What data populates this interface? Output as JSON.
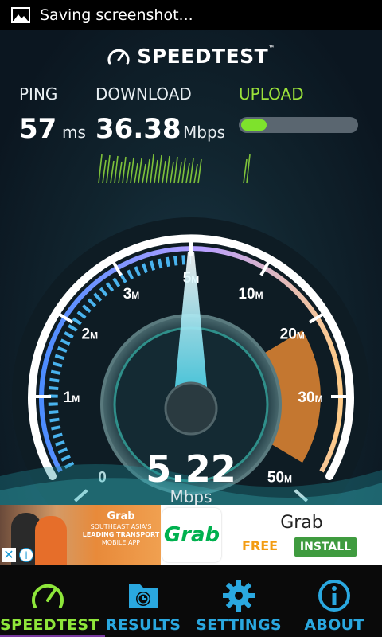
{
  "status_bar": {
    "text": "Saving screenshot..."
  },
  "app": {
    "brand": "SPEEDTEST",
    "trademark": "™"
  },
  "metrics": {
    "ping": {
      "label": "PING",
      "value": "57",
      "unit": "ms"
    },
    "download": {
      "label": "DOWNLOAD",
      "value": "36.38",
      "unit": "Mbps"
    },
    "upload": {
      "label": "UPLOAD",
      "progress_fraction": 0.22
    }
  },
  "gauge": {
    "ticks": [
      "0",
      "1M",
      "2M",
      "3M",
      "5M",
      "10M",
      "20M",
      "30M",
      "50M"
    ],
    "needle_value_label": "5M",
    "current_value": "5.22",
    "current_unit": "Mbps"
  },
  "ad": {
    "brand_small": "Grab",
    "tagline_1": "SOUTHEAST ASIA'S",
    "tagline_2": "LEADING TRANSPORT",
    "tagline_3": "MOBILE APP",
    "logo_text": "Grab",
    "app_name": "Grab",
    "price": "FREE",
    "install_label": "INSTALL",
    "close_symbol": "✕",
    "info_symbol": "i"
  },
  "nav": [
    {
      "label": "SPEEDTEST",
      "icon": "speedometer-icon",
      "active": true
    },
    {
      "label": "RESULTS",
      "icon": "folder-clock-icon",
      "active": false
    },
    {
      "label": "SETTINGS",
      "icon": "gear-icon",
      "active": false
    },
    {
      "label": "ABOUT",
      "icon": "info-icon",
      "active": false
    }
  ],
  "colors": {
    "accent_green": "#8ee63a",
    "nav_blue": "#2aa8e0",
    "gauge_purple": "#b9a0ff",
    "gauge_orange": "#f08a30"
  }
}
